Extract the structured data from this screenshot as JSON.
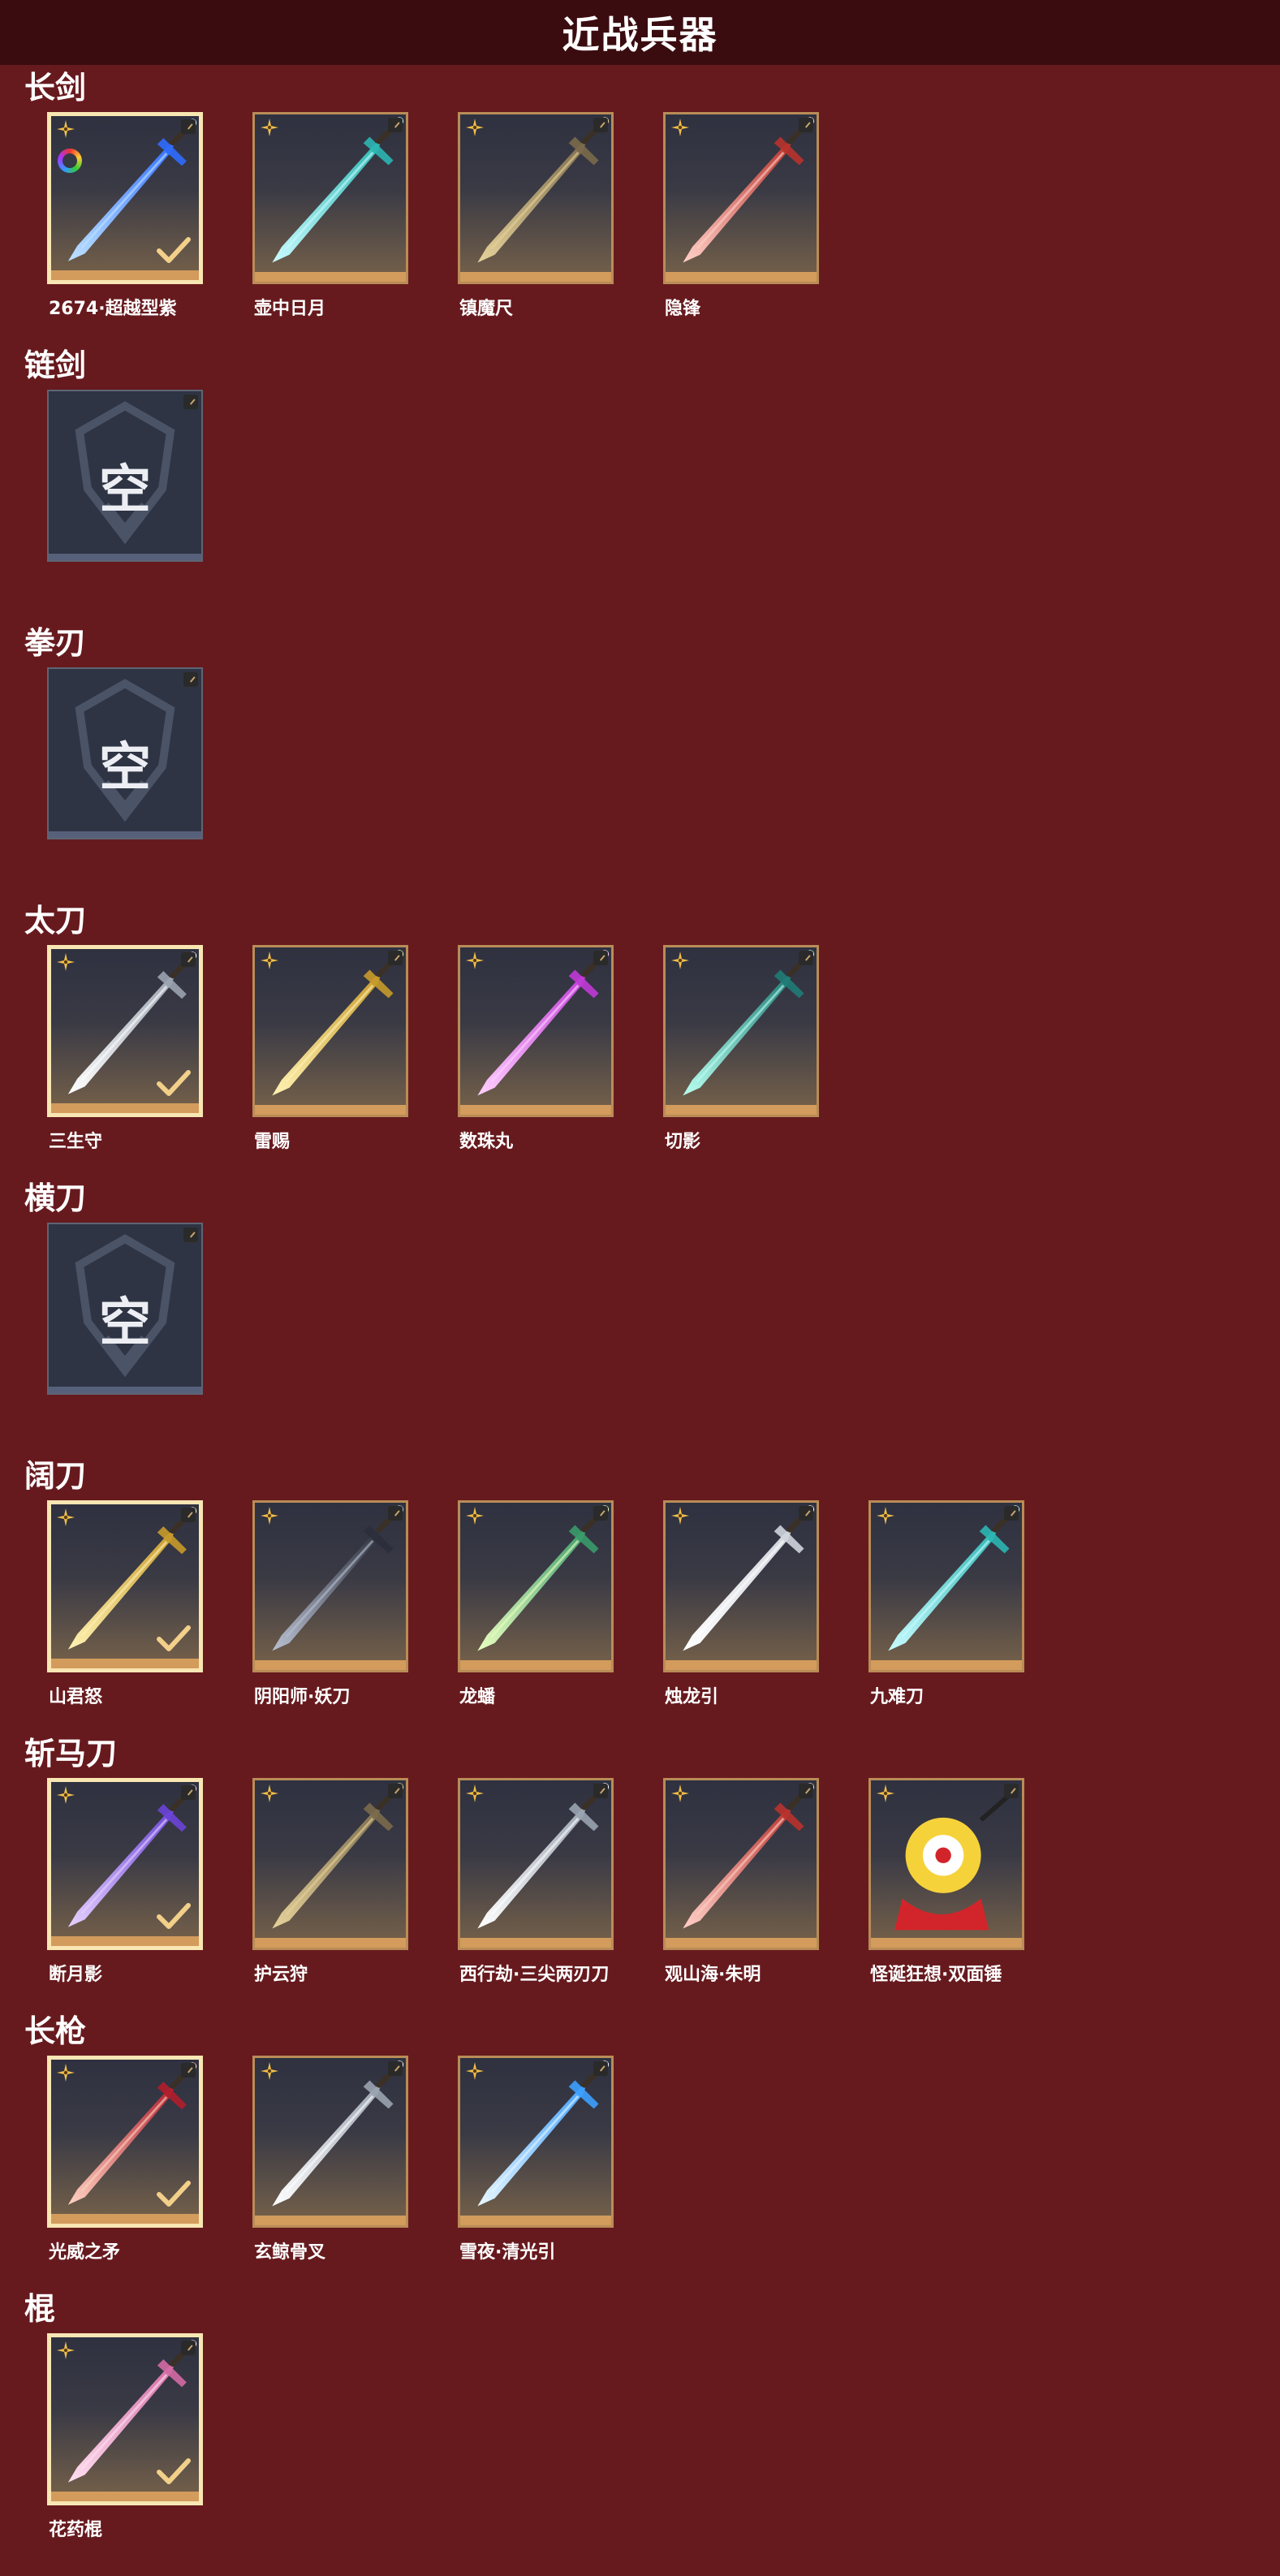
{
  "header": {
    "title": "近战兵器"
  },
  "colors": {
    "background": "#671a1e",
    "header": "#3a0c10",
    "card_border": "#b98c57",
    "selected_border": "#f8e6b3",
    "check": "#f2d08a"
  },
  "categories": [
    {
      "label": "长剑",
      "items": [
        {
          "name": "2674·超越型紫",
          "selected": true,
          "empty": false,
          "art": "blue",
          "extra_icon": "color-ring-icon"
        },
        {
          "name": "壶中日月",
          "selected": false,
          "empty": false,
          "art": "cyan"
        },
        {
          "name": "镇魔尺",
          "selected": false,
          "empty": false,
          "art": "bronze"
        },
        {
          "name": "隐锋",
          "selected": false,
          "empty": false,
          "art": "red"
        }
      ]
    },
    {
      "label": "链剑",
      "items": [
        {
          "name": "",
          "selected": false,
          "empty": true,
          "empty_text": "空"
        }
      ]
    },
    {
      "label": "拳刃",
      "items": [
        {
          "name": "",
          "selected": false,
          "empty": true,
          "empty_text": "空"
        }
      ]
    },
    {
      "label": "太刀",
      "items": [
        {
          "name": "三生守",
          "selected": true,
          "empty": false,
          "art": "silver"
        },
        {
          "name": "雷赐",
          "selected": false,
          "empty": false,
          "art": "gold"
        },
        {
          "name": "数珠丸",
          "selected": false,
          "empty": false,
          "art": "magenta"
        },
        {
          "name": "切影",
          "selected": false,
          "empty": false,
          "art": "teal"
        }
      ]
    },
    {
      "label": "横刀",
      "items": [
        {
          "name": "",
          "selected": false,
          "empty": true,
          "empty_text": "空"
        }
      ]
    },
    {
      "label": "阔刀",
      "items": [
        {
          "name": "山君怒",
          "selected": true,
          "empty": false,
          "art": "gold"
        },
        {
          "name": "阴阳师·妖刀",
          "selected": false,
          "empty": false,
          "art": "dark"
        },
        {
          "name": "龙蟠",
          "selected": false,
          "empty": false,
          "art": "green"
        },
        {
          "name": "烛龙引",
          "selected": false,
          "empty": false,
          "art": "white"
        },
        {
          "name": "九难刀",
          "selected": false,
          "empty": false,
          "art": "cyan"
        }
      ]
    },
    {
      "label": "斩马刀",
      "items": [
        {
          "name": "断月影",
          "selected": true,
          "empty": false,
          "art": "purple"
        },
        {
          "name": "护云狩",
          "selected": false,
          "empty": false,
          "art": "bronze"
        },
        {
          "name": "西行劫·三尖两刃刀",
          "selected": false,
          "empty": false,
          "art": "silver"
        },
        {
          "name": "观山海·朱明",
          "selected": false,
          "empty": false,
          "art": "red"
        },
        {
          "name": "怪诞狂想·双面锤",
          "selected": false,
          "empty": false,
          "art": "clown"
        }
      ]
    },
    {
      "label": "长枪",
      "items": [
        {
          "name": "光威之矛",
          "selected": true,
          "empty": false,
          "art": "crimson"
        },
        {
          "name": "玄鲸骨叉",
          "selected": false,
          "empty": false,
          "art": "silver"
        },
        {
          "name": "雪夜·清光引",
          "selected": false,
          "empty": false,
          "art": "ice"
        }
      ]
    },
    {
      "label": "棍",
      "items": [
        {
          "name": "花药棍",
          "selected": true,
          "empty": false,
          "art": "pink"
        }
      ]
    }
  ]
}
